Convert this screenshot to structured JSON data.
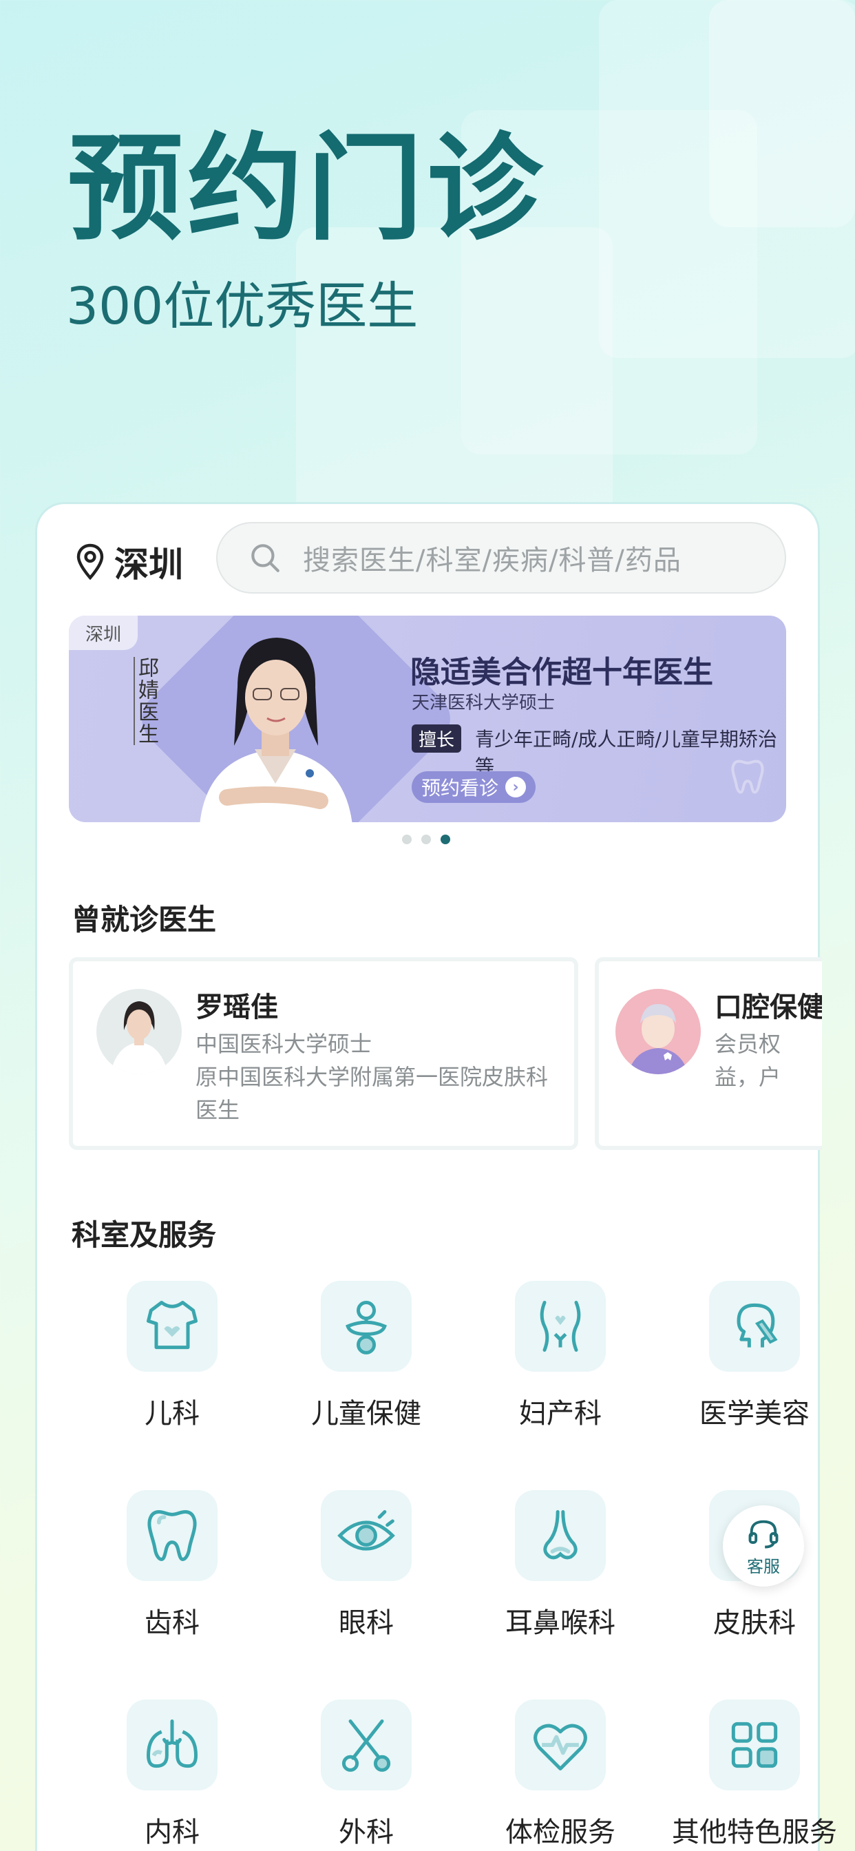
{
  "hero": {
    "title": "预约门诊",
    "subtitle": "300位优秀医生"
  },
  "location": {
    "city": "深圳"
  },
  "search": {
    "placeholder": "搜索医生/科室/疾病/科普/药品"
  },
  "banner": {
    "city_tag": "深圳",
    "doctor_name": "邱婧医生",
    "title": "隐适美合作超十年医生",
    "subtitle": "天津医科大学硕士",
    "specialty_tag": "擅长",
    "specialty": "青少年正畸/成人正畸/儿童早期矫治等",
    "button": "预约看诊",
    "page_index": 3,
    "page_count": 3
  },
  "visited": {
    "title": "曾就诊医生",
    "cards": [
      {
        "name": "罗瑶佳",
        "desc": "中国医科大学硕士\n原中国医科大学附属第一医院皮肤科医生"
      },
      {
        "name": "口腔保健",
        "desc": "会员权益，户"
      }
    ]
  },
  "departments": {
    "title": "科室及服务",
    "items": [
      {
        "label": "儿科",
        "icon": "baby-clothes-icon"
      },
      {
        "label": "儿童保健",
        "icon": "pacifier-icon"
      },
      {
        "label": "妇产科",
        "icon": "uterus-icon"
      },
      {
        "label": "医学美容",
        "icon": "face-beauty-icon"
      },
      {
        "label": "齿科",
        "icon": "tooth-icon"
      },
      {
        "label": "眼科",
        "icon": "eye-icon"
      },
      {
        "label": "耳鼻喉科",
        "icon": "nose-icon"
      },
      {
        "label": "皮肤科",
        "icon": "skin-icon"
      },
      {
        "label": "内科",
        "icon": "lungs-icon"
      },
      {
        "label": "外科",
        "icon": "scissors-icon"
      },
      {
        "label": "体检服务",
        "icon": "heart-pulse-icon"
      },
      {
        "label": "其他特色服务",
        "icon": "grid-icon"
      }
    ]
  },
  "customer_service": {
    "label": "客服"
  },
  "colors": {
    "accent": "#1e6c74",
    "icon_stroke": "#3aa6ae",
    "banner_bg": "#c6c6ee"
  }
}
